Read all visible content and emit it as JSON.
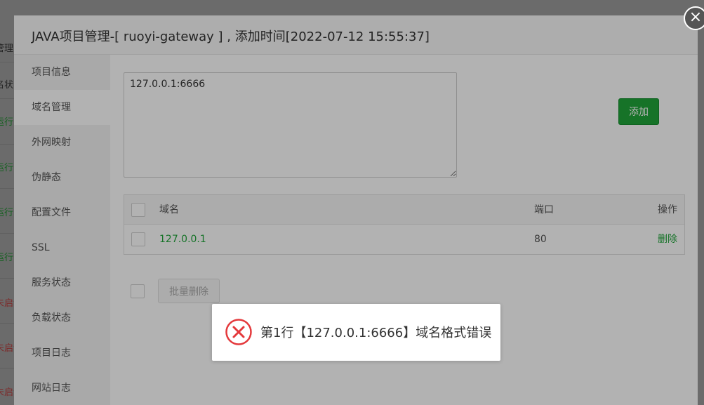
{
  "modal": {
    "title": "JAVA项目管理-[ ruoyi-gateway ] , 添加时间[2022-07-12 15:55:37]",
    "close_icon": "close-icon"
  },
  "background_fragments": [
    {
      "text": "管理",
      "color": "#333333"
    },
    {
      "text": "名状",
      "color": "#333333"
    },
    {
      "text": "运行中",
      "color": "#1f8a2f"
    },
    {
      "text": "运行中",
      "color": "#1f8a2f"
    },
    {
      "text": "运行中",
      "color": "#1f8a2f"
    },
    {
      "text": "运行中",
      "color": "#1f8a2f"
    },
    {
      "text": "未启动",
      "color": "#b33a3a"
    },
    {
      "text": "未启动",
      "color": "#b33a3a"
    },
    {
      "text": "未启动",
      "color": "#b33a3a"
    }
  ],
  "sidebar": {
    "items": [
      {
        "label": "项目信息",
        "active": false
      },
      {
        "label": "域名管理",
        "active": true
      },
      {
        "label": "外网映射",
        "active": false
      },
      {
        "label": "伪静态",
        "active": false
      },
      {
        "label": "配置文件",
        "active": false
      },
      {
        "label": "SSL",
        "active": false
      },
      {
        "label": "服务状态",
        "active": false
      },
      {
        "label": "负载状态",
        "active": false
      },
      {
        "label": "项目日志",
        "active": false
      },
      {
        "label": "网站日志",
        "active": false
      }
    ]
  },
  "domain_form": {
    "textarea_value": "127.0.0.1:6666",
    "add_label": "添加"
  },
  "table": {
    "headers": {
      "domain": "域名",
      "port": "端口",
      "ops": "操作"
    },
    "rows": [
      {
        "domain": "127.0.0.1",
        "port": "80",
        "action": "删除"
      }
    ]
  },
  "batch": {
    "delete_label": "批量删除"
  },
  "toast": {
    "icon": "error-circle-icon",
    "message": "第1行【127.0.0.1:6666】域名格式错误",
    "color": "#e4393c"
  },
  "colors": {
    "accent_green": "#20a53a",
    "error_red": "#e4393c"
  }
}
